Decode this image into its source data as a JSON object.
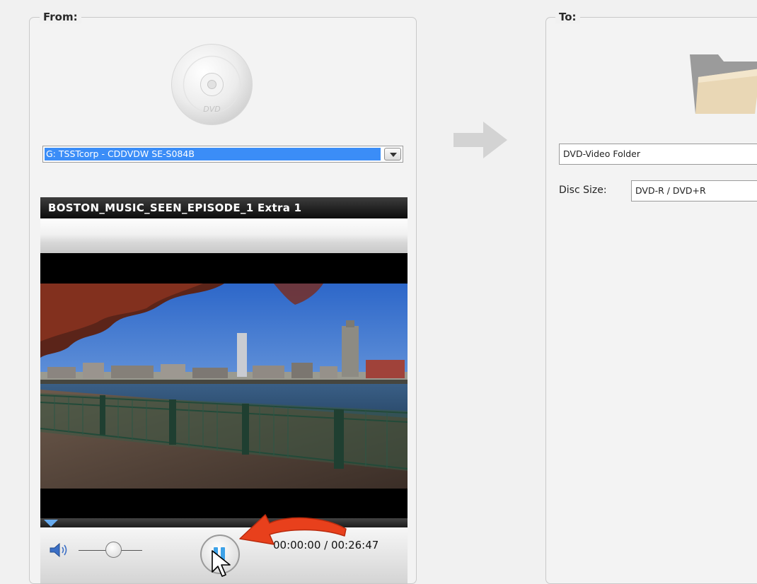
{
  "source": {
    "group_label": "From:",
    "drive_value": "G: TSSTcorp - CDDVDW SE-S084B",
    "dvd_icon_label": "DVD"
  },
  "target": {
    "group_label": "To:",
    "format_value": "DVD-Video Folder",
    "disc_size_label": "Disc Size:",
    "disc_size_value": "DVD-R / DVD+R"
  },
  "player": {
    "title": "BOSTON_MUSIC_SEEN_EPISODE_1 Extra 1",
    "time_display": "00:00:00 / 00:26:47",
    "seek_position": 0,
    "volume_level": 0.55
  },
  "icons": [
    "dvd-disc-icon",
    "folder-icon",
    "right-arrow-icon",
    "speaker-icon",
    "pause-icon",
    "mouse-cursor-icon",
    "red-callout-arrow-icon"
  ],
  "colors": {
    "selection_blue": "#3b8df7",
    "seek_handle_blue": "#66aaee",
    "pause_icon_blue": "#3da2e8",
    "annotation_red": "#e8401c"
  }
}
